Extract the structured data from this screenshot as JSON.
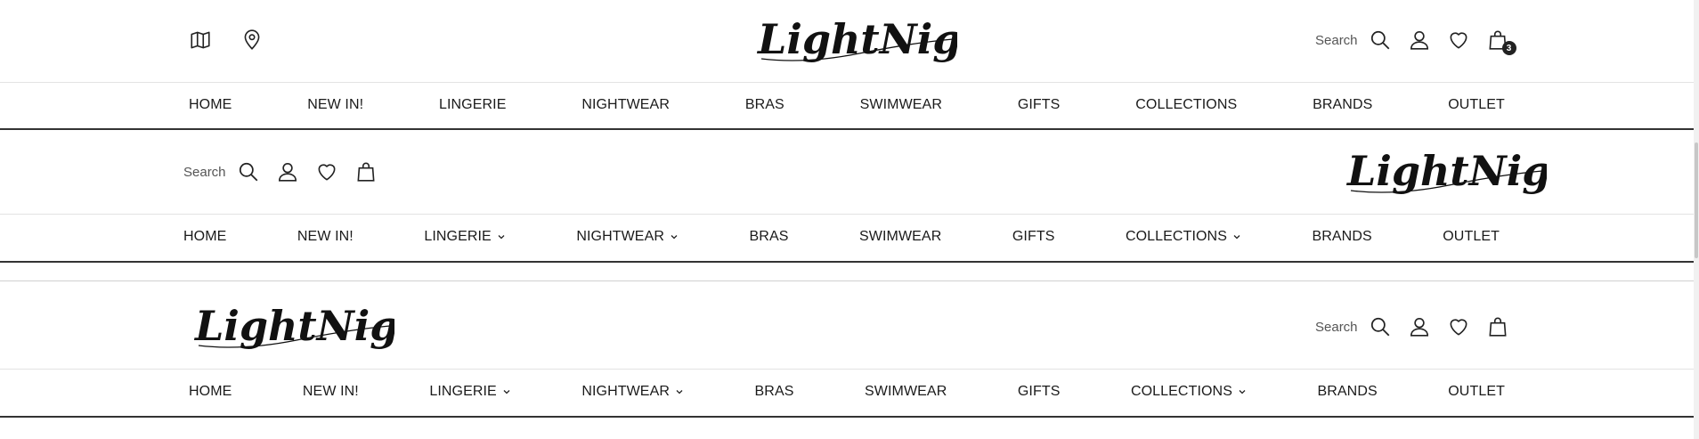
{
  "header1": {
    "logo": "LightNight",
    "search_label": "Search",
    "cart_count": "3",
    "nav": [
      {
        "label": "HOME",
        "dropdown": false
      },
      {
        "label": "NEW IN!",
        "dropdown": false
      },
      {
        "label": "LINGERIE",
        "dropdown": false
      },
      {
        "label": "NIGHTWEAR",
        "dropdown": false
      },
      {
        "label": "BRAS",
        "dropdown": false
      },
      {
        "label": "SWIMWEAR",
        "dropdown": false
      },
      {
        "label": "GIFTS",
        "dropdown": false
      },
      {
        "label": "COLLECTIONS",
        "dropdown": false
      },
      {
        "label": "BRANDS",
        "dropdown": false
      },
      {
        "label": "OUTLET",
        "dropdown": false
      }
    ]
  },
  "header2": {
    "logo": "LightNight",
    "search_label": "Search",
    "nav": [
      {
        "label": "HOME",
        "dropdown": false
      },
      {
        "label": "NEW IN!",
        "dropdown": false
      },
      {
        "label": "LINGERIE",
        "dropdown": true
      },
      {
        "label": "NIGHTWEAR",
        "dropdown": true
      },
      {
        "label": "BRAS",
        "dropdown": false
      },
      {
        "label": "SWIMWEAR",
        "dropdown": false
      },
      {
        "label": "GIFTS",
        "dropdown": false
      },
      {
        "label": "COLLECTIONS",
        "dropdown": true
      },
      {
        "label": "BRANDS",
        "dropdown": false
      },
      {
        "label": "OUTLET",
        "dropdown": false
      }
    ]
  },
  "header3": {
    "logo": "LightNight",
    "search_label": "Search",
    "nav": [
      {
        "label": "HOME",
        "dropdown": false
      },
      {
        "label": "NEW IN!",
        "dropdown": false
      },
      {
        "label": "LINGERIE",
        "dropdown": true
      },
      {
        "label": "NIGHTWEAR",
        "dropdown": true
      },
      {
        "label": "BRAS",
        "dropdown": false
      },
      {
        "label": "SWIMWEAR",
        "dropdown": false
      },
      {
        "label": "GIFTS",
        "dropdown": false
      },
      {
        "label": "COLLECTIONS",
        "dropdown": true
      },
      {
        "label": "BRANDS",
        "dropdown": false
      },
      {
        "label": "OUTLET",
        "dropdown": false
      }
    ]
  },
  "icons": {
    "map": "map-icon",
    "location": "location-pin-icon",
    "search": "search-icon",
    "account": "user-icon",
    "wishlist": "heart-icon",
    "cart": "shopping-bag-icon",
    "dropdown": "chevron-down-icon"
  },
  "colors": {
    "text": "#1a1a1a",
    "rule": "#333333",
    "badge": "#222222"
  }
}
